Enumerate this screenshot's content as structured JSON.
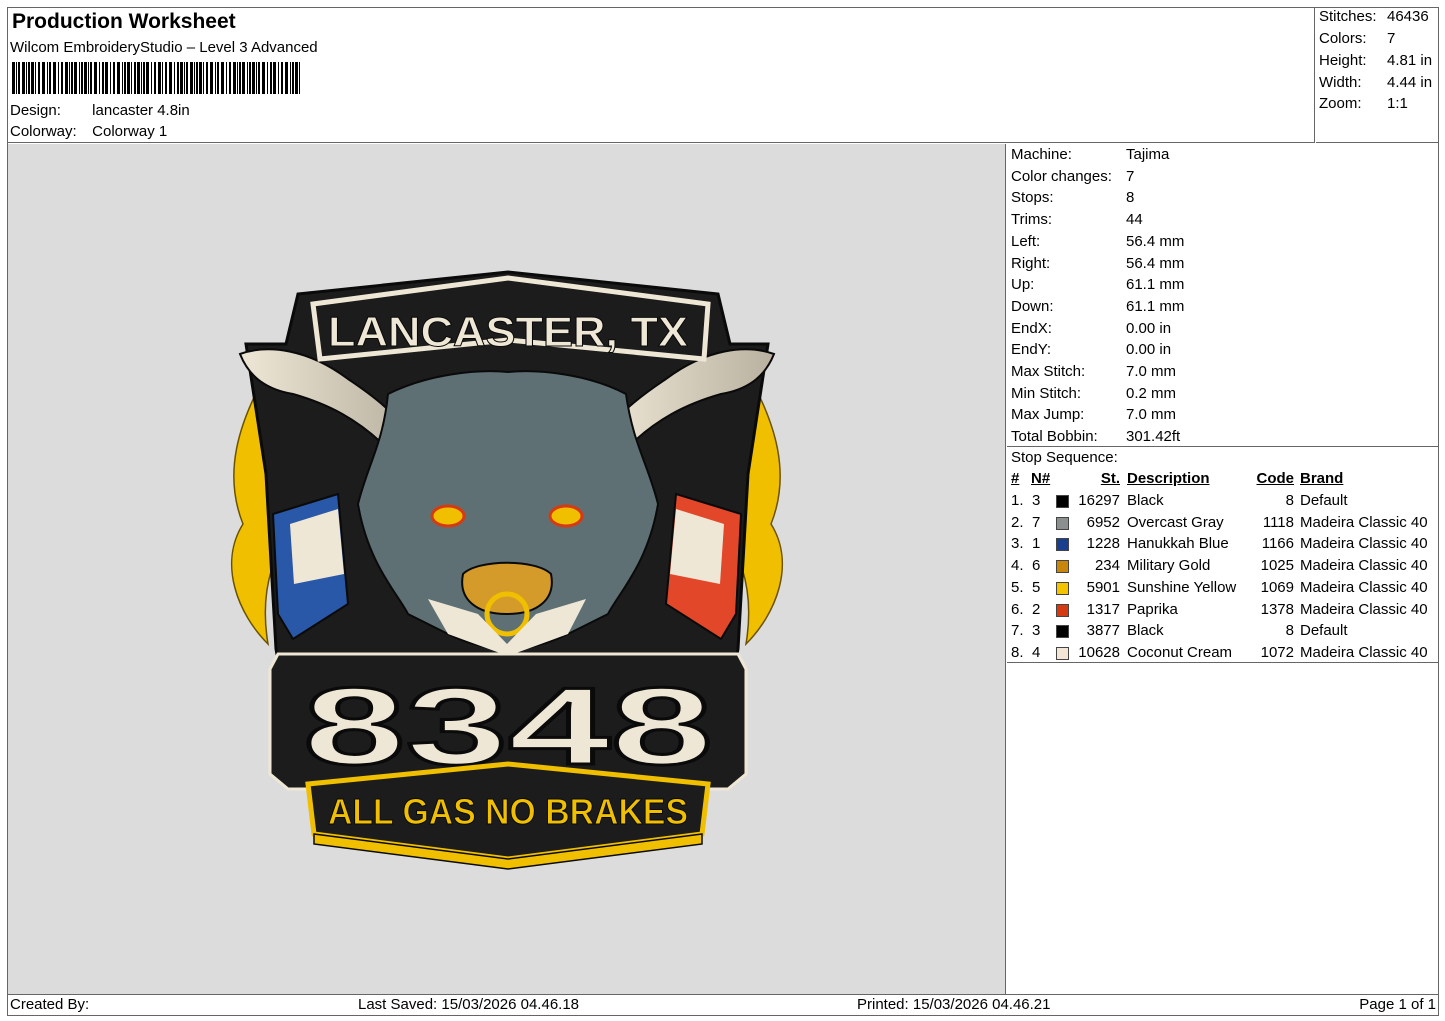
{
  "header": {
    "title": "Production Worksheet",
    "software": "Wilcom EmbroideryStudio – Level 3 Advanced",
    "design_label": "Design:",
    "design_value": "lancaster 4.8in",
    "colorway_label": "Colorway:",
    "colorway_value": "Colorway 1"
  },
  "stats": [
    {
      "label": "Stitches:",
      "value": "46436"
    },
    {
      "label": "Colors:",
      "value": "7"
    },
    {
      "label": "Height:",
      "value": "4.81 in"
    },
    {
      "label": "Width:",
      "value": "4.44 in"
    },
    {
      "label": "Zoom:",
      "value": "1:1"
    }
  ],
  "machine_info": [
    {
      "label": "Machine:",
      "value": "Tajima"
    },
    {
      "label": "Color changes:",
      "value": "7"
    },
    {
      "label": "Stops:",
      "value": "8"
    },
    {
      "label": "Trims:",
      "value": "44"
    },
    {
      "label": "Left:",
      "value": "56.4 mm"
    },
    {
      "label": "Right:",
      "value": "56.4 mm"
    },
    {
      "label": "Up:",
      "value": "61.1 mm"
    },
    {
      "label": "Down:",
      "value": "61.1 mm"
    },
    {
      "label": "EndX:",
      "value": "0.00 in"
    },
    {
      "label": "EndY:",
      "value": "0.00 in"
    },
    {
      "label": "Max Stitch:",
      "value": "7.0 mm"
    },
    {
      "label": "Min Stitch:",
      "value": "0.2 mm"
    },
    {
      "label": "Max Jump:",
      "value": "7.0 mm"
    },
    {
      "label": "Total Bobbin:",
      "value": "301.42ft"
    }
  ],
  "stop_sequence": {
    "title": "Stop Sequence:",
    "columns": {
      "hash": "#",
      "num": "N#",
      "st": "St.",
      "description": "Description",
      "code": "Code",
      "brand": "Brand"
    },
    "rows": [
      {
        "idx": "1.",
        "n": "3",
        "color": "#000000",
        "st": "16297",
        "desc": "Black",
        "code": "8",
        "brand": "Default"
      },
      {
        "idx": "2.",
        "n": "7",
        "color": "#8c8f90",
        "st": "6952",
        "desc": "Overcast Gray",
        "code": "1118",
        "brand": "Madeira Classic 40"
      },
      {
        "idx": "3.",
        "n": "1",
        "color": "#1a3f8f",
        "st": "1228",
        "desc": "Hanukkah Blue",
        "code": "1166",
        "brand": "Madeira Classic 40"
      },
      {
        "idx": "4.",
        "n": "6",
        "color": "#c8860a",
        "st": "234",
        "desc": "Military Gold",
        "code": "1025",
        "brand": "Madeira Classic 40"
      },
      {
        "idx": "5.",
        "n": "5",
        "color": "#f5c400",
        "st": "5901",
        "desc": "Sunshine Yellow",
        "code": "1069",
        "brand": "Madeira Classic 40"
      },
      {
        "idx": "6.",
        "n": "2",
        "color": "#d63a12",
        "st": "1317",
        "desc": "Paprika",
        "code": "1378",
        "brand": "Madeira Classic 40"
      },
      {
        "idx": "7.",
        "n": "3",
        "color": "#000000",
        "st": "3877",
        "desc": "Black",
        "code": "8",
        "brand": "Default"
      },
      {
        "idx": "8.",
        "n": "4",
        "color": "#f3e6d6",
        "st": "10628",
        "desc": "Coconut Cream",
        "code": "1072",
        "brand": "Madeira Classic 40"
      }
    ]
  },
  "patch": {
    "top_text": "LANCASTER, TX",
    "number_text": "8348",
    "bottom_text": "ALL GAS NO BRAKES"
  },
  "footer": {
    "created_by": "Created By:",
    "last_saved": "Last Saved: 15/03/2026 04.46.18",
    "printed": "Printed: 15/03/2026 04.46.21",
    "page": "Page 1 of 1"
  }
}
